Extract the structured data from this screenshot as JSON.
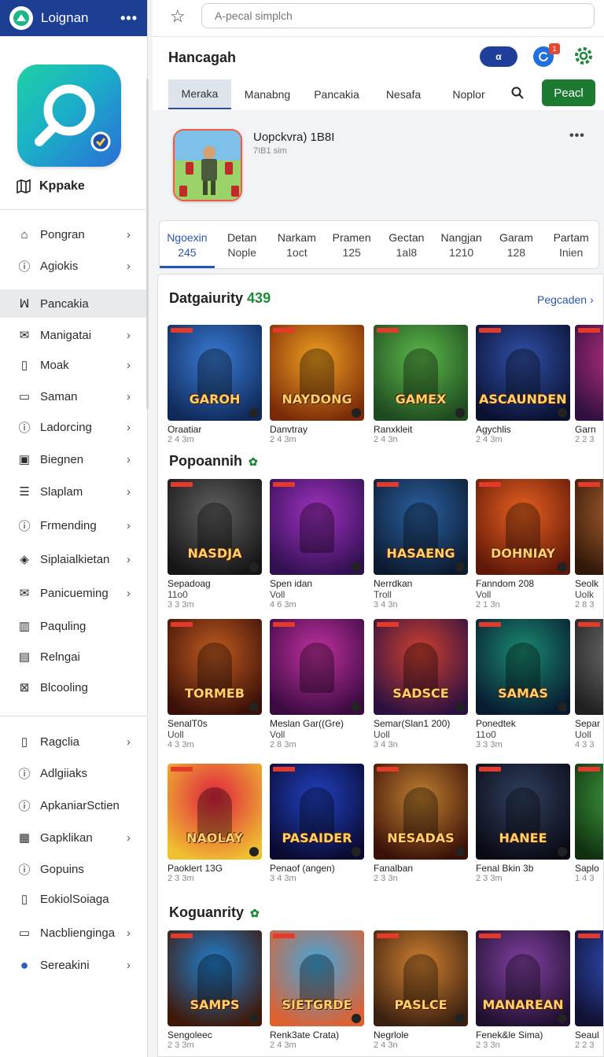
{
  "sidebar": {
    "title": "Loignan",
    "more": "•••",
    "app_name": "Kppake",
    "items": [
      {
        "label": "Pongran",
        "icon": "home-icon",
        "chevron": true
      },
      {
        "label": "Agiokis",
        "icon": "info-icon",
        "chevron": true
      },
      {
        "label": "Pancakia",
        "icon": "activity-icon",
        "chevron": false,
        "active": true
      },
      {
        "label": "Manigatai",
        "icon": "mail-icon",
        "chevron": true
      },
      {
        "label": "Moak",
        "icon": "document-icon",
        "chevron": true
      },
      {
        "label": "Saman",
        "icon": "chat-icon",
        "chevron": true
      },
      {
        "label": "Ladorcing",
        "icon": "info-icon",
        "chevron": true
      },
      {
        "label": "Biegnen",
        "icon": "image-icon",
        "chevron": true
      },
      {
        "label": "Slaplam",
        "icon": "list-icon",
        "chevron": true
      },
      {
        "label": "Frmending",
        "icon": "info-icon",
        "chevron": true
      },
      {
        "label": "Siplaialkietan",
        "icon": "box-icon",
        "chevron": true
      },
      {
        "label": "Panicueming",
        "icon": "mail-open-icon",
        "chevron": true
      },
      {
        "label": "Paquling",
        "icon": "chart-icon",
        "chevron": false
      },
      {
        "label": "Relngai",
        "icon": "clipboard-icon",
        "chevron": false
      },
      {
        "label": "Blcooling",
        "icon": "close-box-icon",
        "chevron": false
      },
      {
        "label": "Ragclia",
        "icon": "document-icon",
        "chevron": true
      },
      {
        "label": "Adlgiiaks",
        "icon": "info-icon",
        "chevron": false
      },
      {
        "label": "ApkaniarSctien",
        "icon": "info-icon",
        "chevron": false
      },
      {
        "label": "Gapklikan",
        "icon": "table-icon",
        "chevron": true
      },
      {
        "label": "Gopuins",
        "icon": "info-icon",
        "chevron": false
      },
      {
        "label": "EokiolSoiaga",
        "icon": "document-icon",
        "chevron": false
      },
      {
        "label": "Nacblienginga",
        "icon": "chat-icon",
        "chevron": true
      },
      {
        "label": "Sereakini",
        "icon": "globe-icon",
        "chevron": true
      }
    ]
  },
  "topbar": {
    "search_placeholder": "A-pecal simplch"
  },
  "header": {
    "title": "Hancagah",
    "pill": "α",
    "badge": "1",
    "tabs": [
      "Meraka",
      "Manabng",
      "Pancakia",
      "Nesafa",
      "Noplor"
    ],
    "primary_button": "Peacl"
  },
  "profile": {
    "title": "Uopckvra) 1B8I",
    "subtitle": "7IB1 sim",
    "more": "•••"
  },
  "stats": [
    {
      "label": "Ngoexin",
      "value": "245",
      "active": true
    },
    {
      "label": "Detan",
      "value": "Nople"
    },
    {
      "label": "Narkam",
      "value": "1oct"
    },
    {
      "label": "Pramen",
      "value": "125"
    },
    {
      "label": "Gectan",
      "value": "1al8"
    },
    {
      "label": "Nangjan",
      "value": "1210"
    },
    {
      "label": "Garam",
      "value": "128"
    },
    {
      "label": "Partam",
      "value": "Inien"
    }
  ],
  "sections": [
    {
      "title": "Datgaiurity",
      "count": "439",
      "see_all": "Pegcaden ›"
    },
    {
      "title": "Popoannih"
    },
    {
      "title": "Koguanrity"
    }
  ],
  "grid_rows": [
    [
      {
        "title": "Oraatiar",
        "sub": "",
        "meta": "2 4 3m",
        "art": "GAROH",
        "colors": [
          "#3a7bd5",
          "#0f2a5a"
        ]
      },
      {
        "title": "Danvtray",
        "sub": "",
        "meta": "2 4 3m",
        "art": "NAYDONG",
        "colors": [
          "#f0a020",
          "#7a2a08"
        ]
      },
      {
        "title": "Ranxkleit",
        "sub": "",
        "meta": "2 4 3n",
        "art": "GAMEX",
        "colors": [
          "#5cb84a",
          "#1e4a20"
        ]
      },
      {
        "title": "Agychlis",
        "sub": "",
        "meta": "2 4 3m",
        "art": "ASCAUNDENNA",
        "colors": [
          "#3050a8",
          "#0a1030"
        ]
      },
      {
        "title": "Garn",
        "sub": "",
        "meta": "2 2 3",
        "art": "",
        "colors": [
          "#c03080",
          "#301040"
        ]
      }
    ],
    [
      {
        "title": "Sepadoag",
        "sub": "11o0",
        "meta": "3 3 3m",
        "art": "NASDJA",
        "colors": [
          "#606060",
          "#151515"
        ]
      },
      {
        "title": "Spen idan",
        "sub": "Voll",
        "meta": "4 6 3m",
        "art": "",
        "colors": [
          "#a030c0",
          "#301050"
        ]
      },
      {
        "title": "Nerrdkan",
        "sub": "Troll",
        "meta": "3 4 3n",
        "art": "HASAENG",
        "colors": [
          "#2a60a0",
          "#0c1a30"
        ]
      },
      {
        "title": "Fanndom 208",
        "sub": "Voll",
        "meta": "2 1 3n",
        "art": "DOHNIAY",
        "colors": [
          "#e86020",
          "#601808"
        ]
      },
      {
        "title": "Seolk",
        "sub": "Uolk",
        "meta": "2 8 3",
        "art": "",
        "colors": [
          "#b06030",
          "#301808"
        ]
      }
    ],
    [
      {
        "title": "SenalT0s",
        "sub": "Uoll",
        "meta": "4 3 3m",
        "art": "TORMEB",
        "colors": [
          "#c05a20",
          "#3a1008"
        ]
      },
      {
        "title": "Meslan Gar((Gre)",
        "sub": "Voll",
        "meta": "2 8 3m",
        "art": "",
        "colors": [
          "#c030a0",
          "#3a0a40"
        ]
      },
      {
        "title": "Semar(Slan1 200)",
        "sub": "Uoll",
        "meta": "3 4 3n",
        "art": "SADSCE",
        "colors": [
          "#d04030",
          "#2a1040"
        ]
      },
      {
        "title": "Ponedtek",
        "sub": "11o0",
        "meta": "3 3 3m",
        "art": "SAMAS",
        "colors": [
          "#1a8a70",
          "#081a30"
        ]
      },
      {
        "title": "Separ",
        "sub": "Uoll",
        "meta": "4 3 3",
        "art": "",
        "colors": [
          "#707070",
          "#202020"
        ]
      }
    ],
    [
      {
        "title": "Paoklert 13G",
        "sub": "",
        "meta": "2 3 3m",
        "art": "NAOLAY",
        "colors": [
          "#e02040",
          "#f0c030"
        ]
      },
      {
        "title": "Penaof (angen)",
        "sub": "",
        "meta": "3 4 3m",
        "art": "PASAIDER",
        "colors": [
          "#2040c0",
          "#0a0a30"
        ]
      },
      {
        "title": "Fanalban",
        "sub": "",
        "meta": "2 3 3n",
        "art": "NESADAS",
        "colors": [
          "#c08030",
          "#3a1008"
        ]
      },
      {
        "title": "Fenal Bkin 3b",
        "sub": "",
        "meta": "2 3 3m",
        "art": "HANEE",
        "colors": [
          "#304060",
          "#0a0a14"
        ]
      },
      {
        "title": "Saplo",
        "sub": "",
        "meta": "1 4 3",
        "art": "",
        "colors": [
          "#40a040",
          "#103010"
        ]
      }
    ],
    [
      {
        "title": "Sengoleec",
        "sub": "",
        "meta": "2 3 3m",
        "art": "SAMPS",
        "colors": [
          "#2080d0",
          "#401808"
        ]
      },
      {
        "title": "Renk3ate Crata)",
        "sub": "",
        "meta": "2 4 3m",
        "art": "SIETGRDE",
        "colors": [
          "#40a8e0",
          "#e06030"
        ]
      },
      {
        "title": "Negrlole",
        "sub": "",
        "meta": "2 4 3n",
        "art": "PASLCE",
        "colors": [
          "#d08030",
          "#3a2010"
        ]
      },
      {
        "title": "Fenek&le Sima)",
        "sub": "",
        "meta": "2 3 3n",
        "art": "MANAREAN",
        "colors": [
          "#8040a0",
          "#201030"
        ]
      },
      {
        "title": "Seaul",
        "sub": "",
        "meta": "2 2 3",
        "art": "",
        "colors": [
          "#3050c0",
          "#101030"
        ]
      }
    ]
  ]
}
